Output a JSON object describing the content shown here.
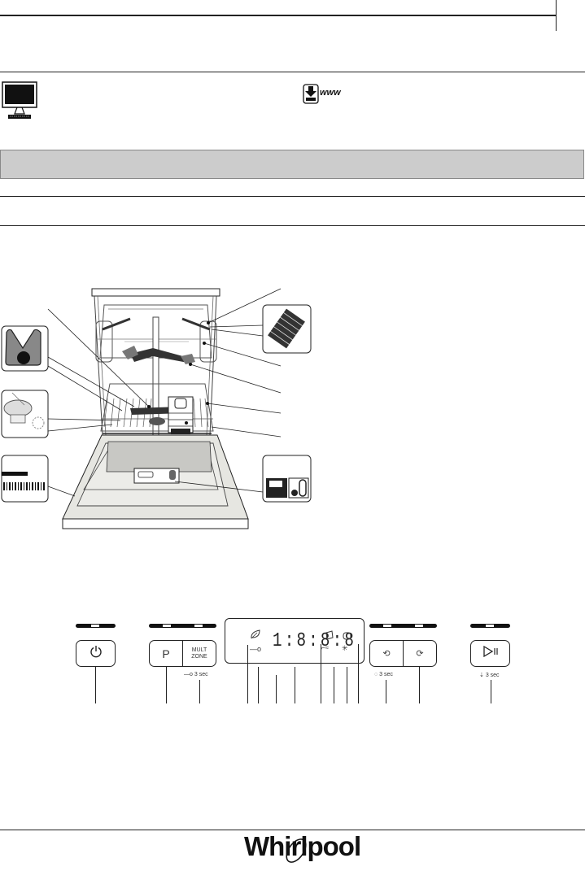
{
  "page": {
    "header_icons": {
      "monitor_icon": "monitor-icon",
      "download_www_icon": "download-icon",
      "www_label": "www"
    },
    "diagram": {
      "description": "Dishwasher front view with open door and racks",
      "callout_insets": [
        "filter-insert",
        "filter-assembly",
        "rating-plate-barcode",
        "cutlery-tray",
        "detergent-dispenser"
      ]
    },
    "control_panel": {
      "power_icon": "power-icon",
      "program_button_label": "P",
      "multizone_label_line1": "MULT",
      "multizone_label_line2": "ZONE",
      "key_lock_hint": "3 sec",
      "display": {
        "time_digits": "1:8:8:8",
        "indicators": [
          "eco-leaf-icon",
          "key-lock-icon",
          "rinse-aid-icon",
          "salt-icon",
          "tap-icon",
          "sanitize-icon"
        ]
      },
      "delay_hint": "3 sec",
      "start_pause_hint": "3 sec"
    },
    "footer": {
      "brand": "Whirlpool"
    }
  }
}
